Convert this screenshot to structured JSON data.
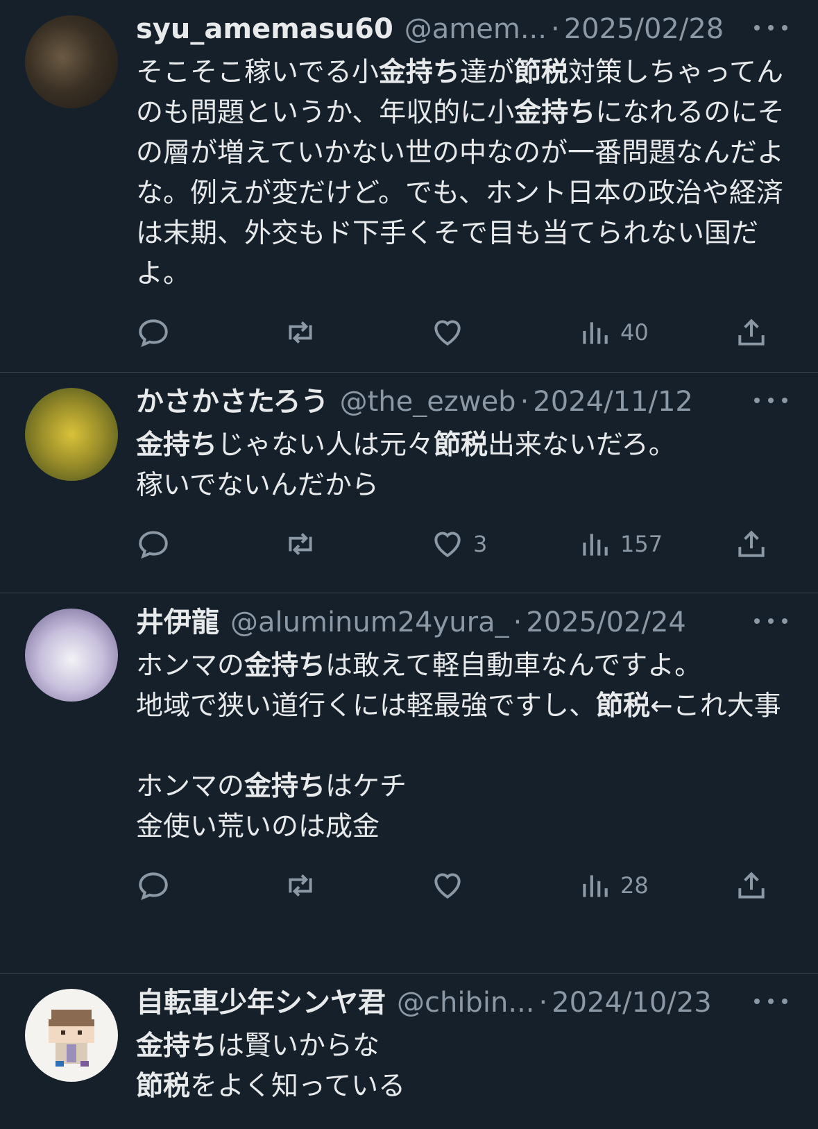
{
  "tweets": [
    {
      "name": "syu_amemasu60",
      "handle": "@amem...",
      "date": "2025/02/28",
      "text_parts": [
        {
          "t": "そこそこ稼いでる小",
          "b": false
        },
        {
          "t": "金持ち",
          "b": true
        },
        {
          "t": "達が",
          "b": false
        },
        {
          "t": "節税",
          "b": true
        },
        {
          "t": "対策しちゃってんのも問題というか、年収的に小",
          "b": false
        },
        {
          "t": "金持ち",
          "b": true
        },
        {
          "t": "になれるのにその層が増えていかない世の中なのが一番問題なんだよな。例えが変だけど。でも、ホント日本の政治や経済は末期、外交もド下手くそで目も当てられない国だよ。",
          "b": false
        }
      ],
      "replies": "",
      "retweets": "",
      "likes": "",
      "views": "40"
    },
    {
      "name": "かさかさたろう",
      "handle": "@the_ezweb",
      "date": "2024/11/12",
      "text_parts": [
        {
          "t": "金持ち",
          "b": true
        },
        {
          "t": "じゃない人は元々",
          "b": false
        },
        {
          "t": "節税",
          "b": true
        },
        {
          "t": "出来ないだろ。\n稼いでないんだから",
          "b": false
        }
      ],
      "replies": "",
      "retweets": "",
      "likes": "3",
      "views": "157"
    },
    {
      "name": "井伊龍",
      "handle": "@aluminum24yura_",
      "date": "2025/02/24",
      "text_parts": [
        {
          "t": "ホンマの",
          "b": false
        },
        {
          "t": "金持ち",
          "b": true
        },
        {
          "t": "は敢えて軽自動車なんですよ。\n地域で狭い道行くには軽最強ですし、",
          "b": false
        },
        {
          "t": "節税",
          "b": true
        },
        {
          "t": "←これ大事\n\nホンマの",
          "b": false
        },
        {
          "t": "金持ち",
          "b": true
        },
        {
          "t": "はケチ\n金使い荒いのは成金",
          "b": false
        }
      ],
      "replies": "",
      "retweets": "",
      "likes": "",
      "views": "28"
    },
    {
      "name": "自転車少年シンヤ君",
      "handle": "@chibin...",
      "date": "2024/10/23",
      "text_parts": [
        {
          "t": "金持ち",
          "b": true
        },
        {
          "t": "は賢いからな\n",
          "b": false
        },
        {
          "t": "節税",
          "b": true
        },
        {
          "t": "をよく知っている",
          "b": false
        }
      ]
    }
  ],
  "separator": "·",
  "icons": {
    "reply": "reply-icon",
    "retweet": "retweet-icon",
    "like": "heart-icon",
    "views": "views-icon",
    "share": "share-icon",
    "more": "more-icon"
  },
  "colors": {
    "background": "#15202b",
    "text": "#e7e9ea",
    "muted": "#8b98a5",
    "divider": "#38444d"
  }
}
